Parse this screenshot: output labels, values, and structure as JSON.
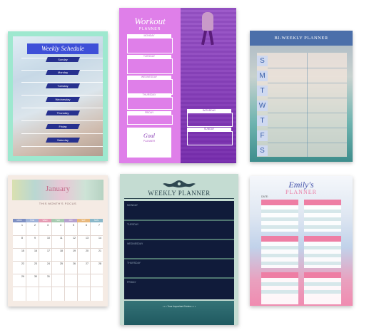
{
  "weekly_schedule": {
    "title": "Weekly Schedule",
    "days": [
      "Sunday",
      "Monday",
      "Tuesday",
      "Wednesday",
      "Thursday",
      "Friday",
      "Saturday"
    ]
  },
  "workout_planner": {
    "title": "Workout",
    "subtitle": "PLANNER",
    "left_days": [
      "MONDAY",
      "TUESDAY",
      "WEDNESDAY",
      "THURSDAY",
      "FRIDAY"
    ],
    "right_days": [
      "SATURDAY",
      "SUNDAY"
    ],
    "goal_title": "Goal",
    "goal_sub": "PLANNER"
  },
  "biweekly_planner": {
    "title": "BI-WEEKLY PLANNER",
    "letters": [
      "S",
      "M",
      "T",
      "W",
      "T",
      "F",
      "S"
    ]
  },
  "calendar": {
    "month": "January",
    "subtitle": "THIS MONTH'S FOCUS",
    "weekdays": [
      "MON",
      "TUE",
      "WED",
      "THU",
      "FRI",
      "SAT",
      "SUN"
    ],
    "weekday_colors": [
      "#7d8fc2",
      "#9fb3d9",
      "#e59bb3",
      "#a6cbb0",
      "#b6a1cf",
      "#e8b87c",
      "#8bb8c9"
    ],
    "numbers": [
      "1",
      "2",
      "3",
      "4",
      "5",
      "6",
      "7",
      "8",
      "9",
      "10",
      "11",
      "12",
      "13",
      "14",
      "15",
      "16",
      "17",
      "18",
      "19",
      "20",
      "21",
      "22",
      "23",
      "24",
      "25",
      "26",
      "27",
      "28",
      "29",
      "30",
      "31"
    ]
  },
  "weekly_planner": {
    "title": "WEEKLY PLANNER",
    "days": [
      "MONDAY",
      "TUESDAY",
      "WEDNESDAY",
      "THURSDAY",
      "FRIDAY"
    ],
    "footer": "• • •   Your Important Notes   • • •"
  },
  "emily_planner": {
    "name": "Emily's",
    "title": "PLANNER",
    "date_label": "DATE:"
  },
  "colors": {
    "weekly_schedule_accent": "#3e50d8",
    "workout_bg": "#df7fe9",
    "biweekly_accent": "#4b6faa",
    "calendar_accent": "#c26d8a",
    "weekly_planner_dark": "#101b3a",
    "emily_pink": "#ee7ea4"
  }
}
